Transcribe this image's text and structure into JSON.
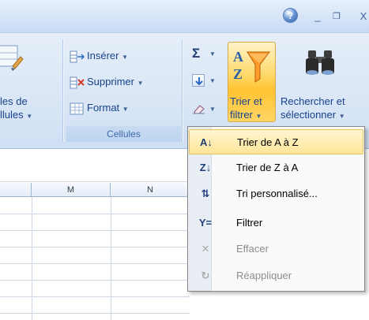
{
  "window": {
    "help_glyph": "?",
    "minimize_glyph": "_",
    "restore_glyph": "❐",
    "close_glyph": "X"
  },
  "ribbon": {
    "styles_group": {
      "label_line1": "les de",
      "label_line2": "llules"
    },
    "cells_group": {
      "insert": "Insérer",
      "delete": "Supprimer",
      "format": "Format",
      "group_label": "Cellules"
    },
    "editing_group": {
      "sum_glyph": "Σ",
      "sort_filter_line1": "Trier et",
      "sort_filter_line2": "filtrer",
      "find_select_line1": "Rechercher et",
      "find_select_line2": "sélectionner"
    }
  },
  "grid": {
    "columns": [
      "M",
      "N"
    ]
  },
  "sort_menu": {
    "items": [
      {
        "label": "Trier de A à Z",
        "icon": "sort-az-icon",
        "glyph": "A↓",
        "active": true,
        "enabled": true
      },
      {
        "label": "Trier de Z à A",
        "icon": "sort-za-icon",
        "glyph": "Z↓",
        "active": false,
        "enabled": true
      },
      {
        "label": "Tri personnalisé...",
        "icon": "custom-sort-icon",
        "glyph": "⇅",
        "active": false,
        "enabled": true
      },
      {
        "label": "Filtrer",
        "icon": "filter-icon",
        "glyph": "Y=",
        "active": false,
        "enabled": true
      },
      {
        "label": "Effacer",
        "icon": "clear-filter-icon",
        "glyph": "✕",
        "active": false,
        "enabled": false
      },
      {
        "label": "Réappliquer",
        "icon": "reapply-filter-icon",
        "glyph": "↻",
        "active": false,
        "enabled": false
      }
    ]
  },
  "colors": {
    "ribbon_text": "#15428b",
    "highlight": "#ffd96c",
    "menu_hover": "#ffe59a"
  }
}
